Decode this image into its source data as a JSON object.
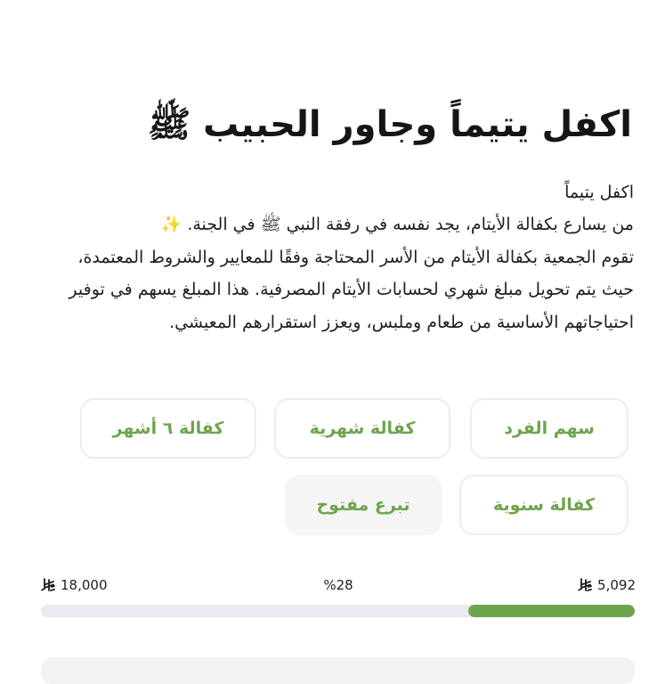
{
  "title": "اكفل يتيماً وجاور الحبيب ﷺ",
  "description": {
    "heading": "اكفل يتيماً",
    "line1": "من يسارع بكفالة الأيتام، يجد نفسه في رفقة النبي ﷺ في الجنة. ✨",
    "body": "تقوم الجمعية بكفالة الأيتام من الأسر المحتاجة وفقًا للمعايير والشروط المعتمدة، حيث يتم تحويل مبلغ شهري لحسابات الأيتام المصرفية. هذا المبلغ يسهم في توفير احتياجاتهم الأساسية من طعام وملبس، ويعزز استقرارهم المعيشي."
  },
  "options": [
    {
      "label": "سهم الفرد"
    },
    {
      "label": "كفالة شهرية"
    },
    {
      "label": "كفالة ٦ أشهر"
    },
    {
      "label": "كفالة سنوية"
    },
    {
      "label": "تبرع مفتوح"
    }
  ],
  "progress": {
    "collected": "5,092",
    "target": "18,000",
    "percent_label": "%28",
    "fraction": 0.28
  },
  "colors": {
    "accent": "#6da44e",
    "track": "#e8ecee"
  },
  "icons": {
    "currency": "saudi-riyal-icon"
  }
}
